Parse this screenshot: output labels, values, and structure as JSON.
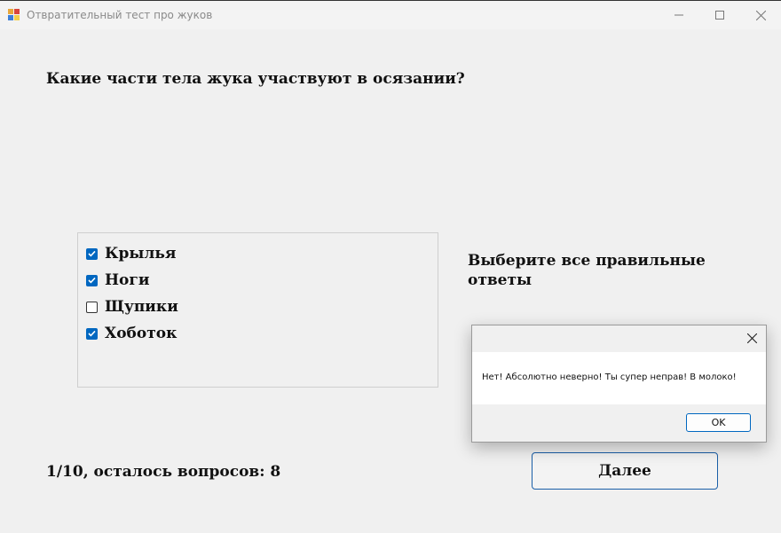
{
  "window": {
    "title": "Отвратительный тест про жуков",
    "icon": "app-icon",
    "controls": [
      "minimize-icon",
      "maximize-icon",
      "close-icon"
    ]
  },
  "question": {
    "text": "Какие части тела жука участвуют в осязании?"
  },
  "options": [
    {
      "label": "Крылья",
      "checked": true
    },
    {
      "label": "Ноги",
      "checked": true
    },
    {
      "label": "Щупики",
      "checked": false
    },
    {
      "label": "Хоботок",
      "checked": true
    }
  ],
  "hint": {
    "text": "Выберите все правильные ответы"
  },
  "progress": {
    "text": "1/10, осталось вопросов: 8"
  },
  "next_button": {
    "label": "Далее"
  },
  "message_box": {
    "text": "Нет! Абсолютно неверно! Ты супер неправ! В молоко!",
    "ok_label": "OK"
  },
  "colors": {
    "accent": "#0067c0",
    "background": "#f0f0f0"
  }
}
